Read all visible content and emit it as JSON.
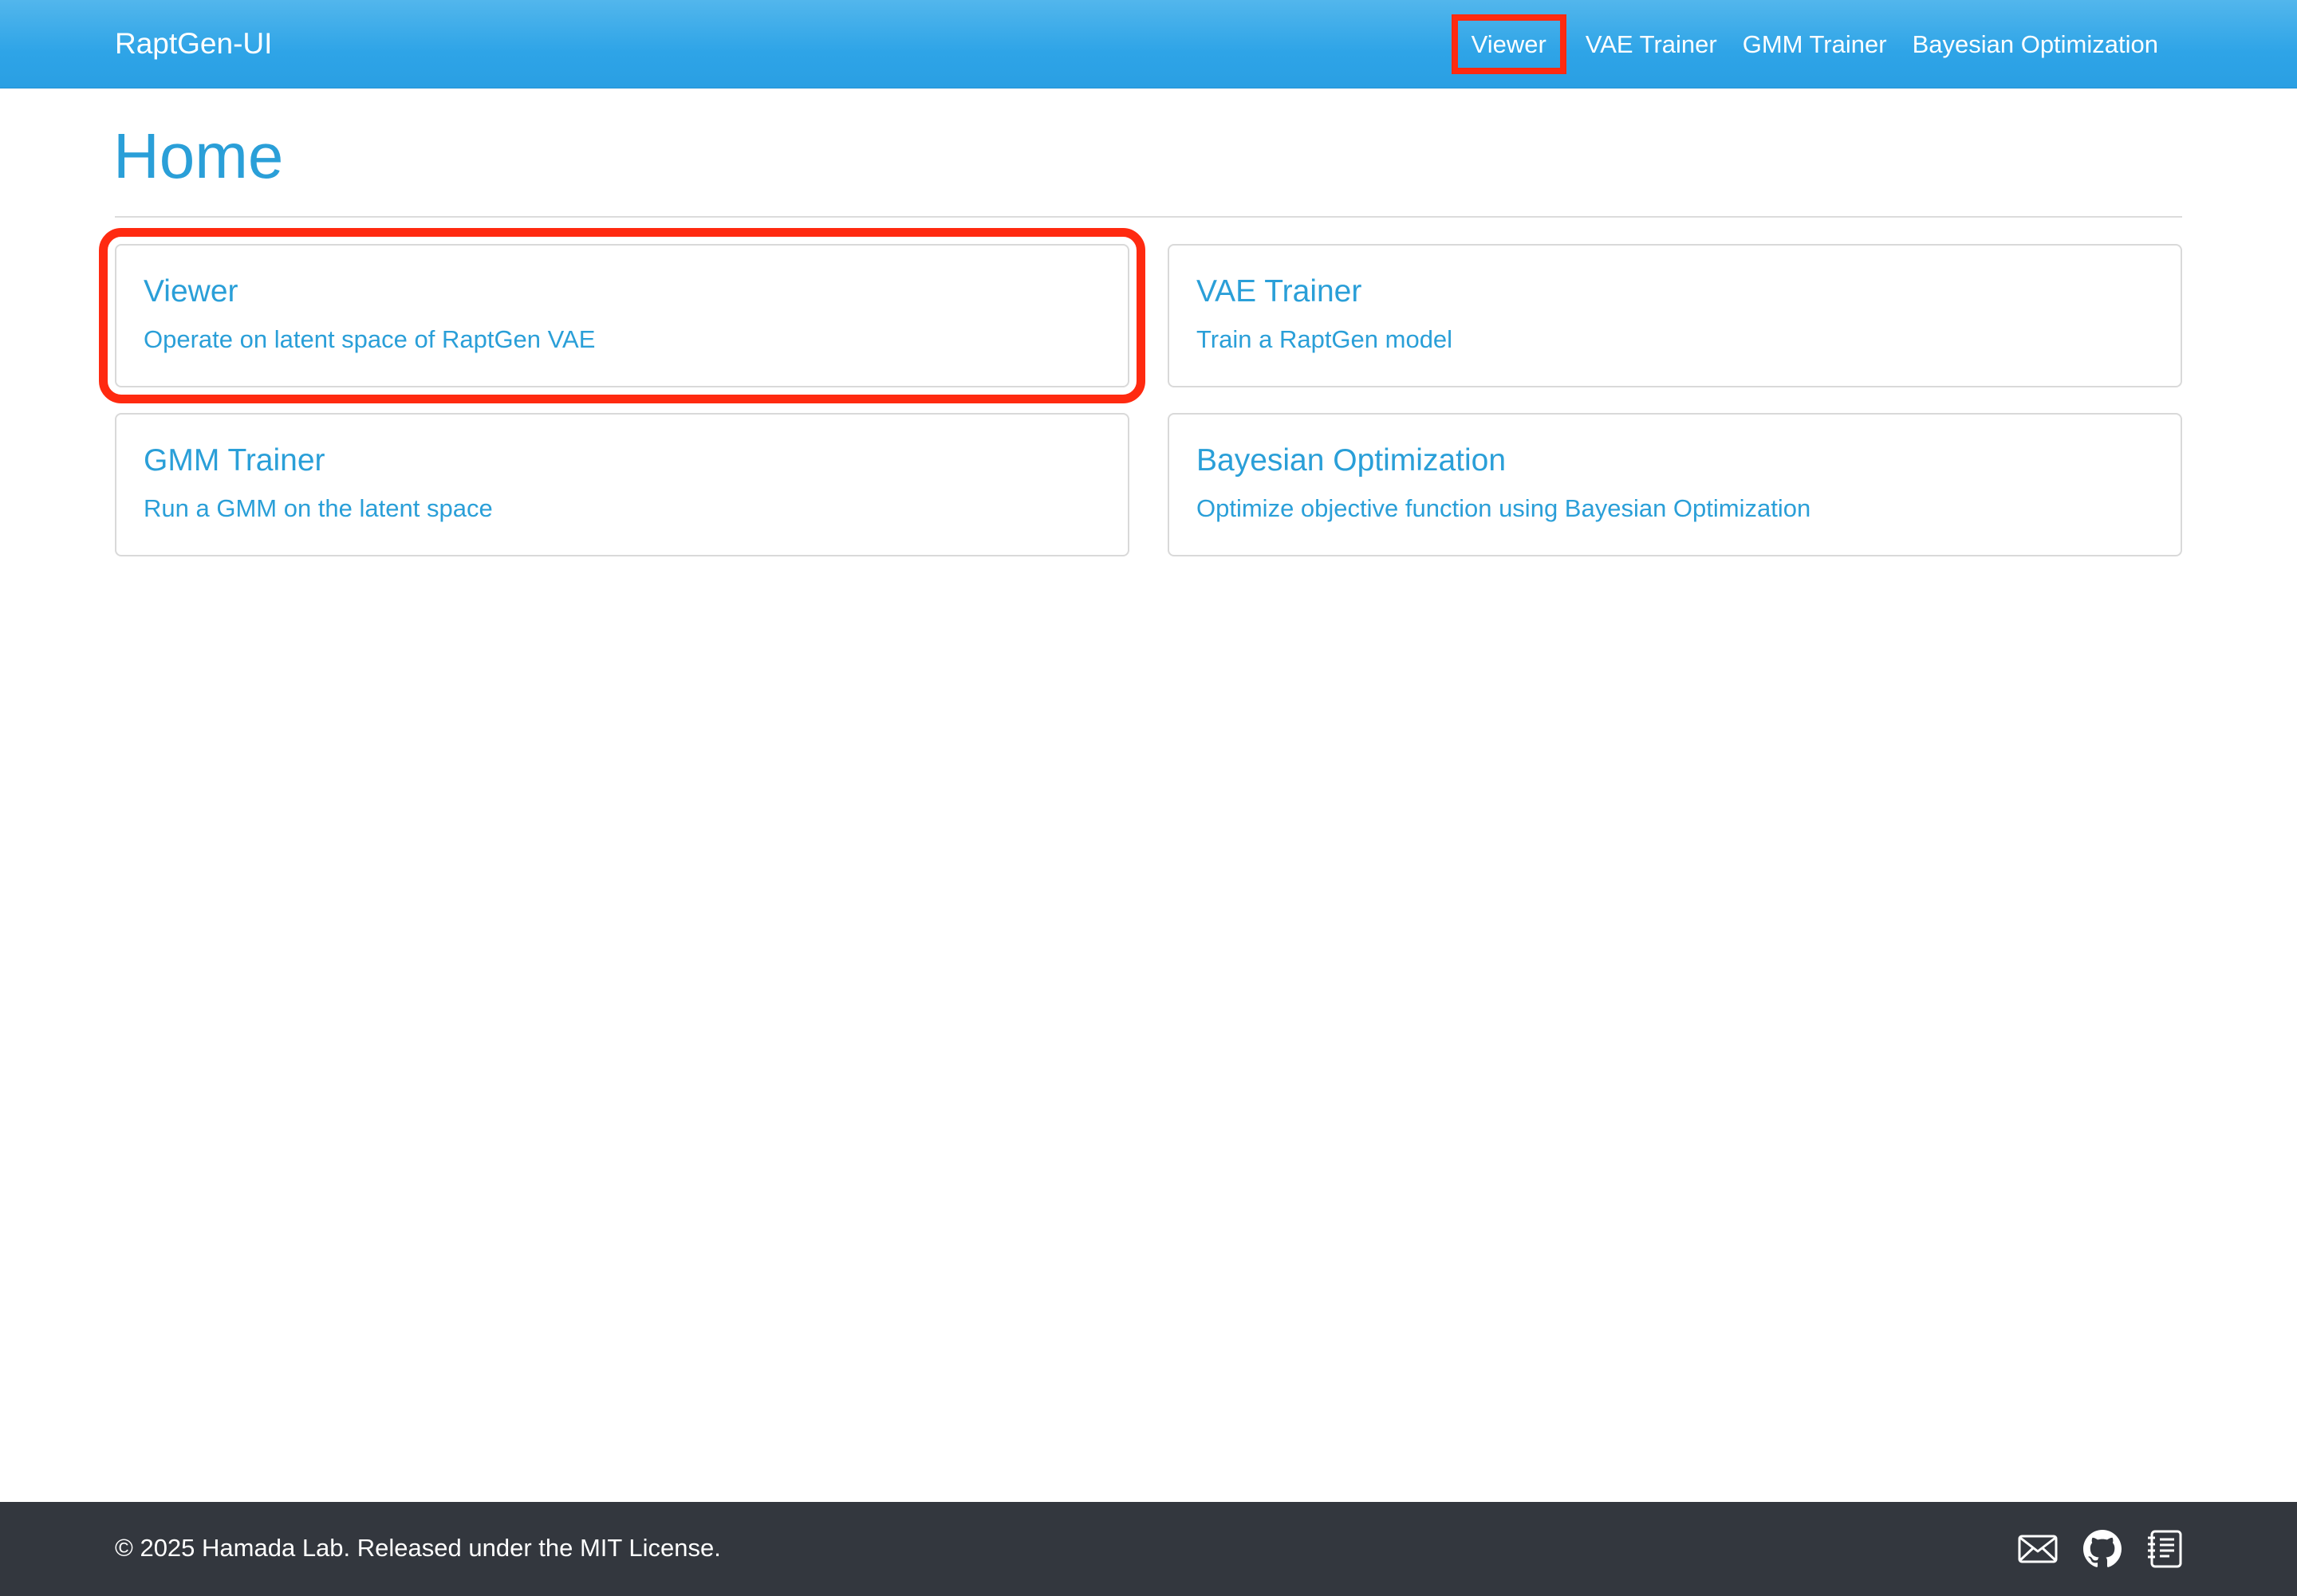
{
  "navbar": {
    "brand": "RaptGen-UI",
    "links": [
      {
        "label": "Viewer"
      },
      {
        "label": "VAE Trainer"
      },
      {
        "label": "GMM Trainer"
      },
      {
        "label": "Bayesian Optimization"
      }
    ]
  },
  "main": {
    "title": "Home",
    "cards": [
      {
        "title": "Viewer",
        "text": "Operate on latent space of RaptGen VAE"
      },
      {
        "title": "VAE Trainer",
        "text": "Train a RaptGen model"
      },
      {
        "title": "GMM Trainer",
        "text": "Run a GMM on the latent space"
      },
      {
        "title": "Bayesian Optimization",
        "text": "Optimize objective function using Bayesian Optimization"
      }
    ]
  },
  "footer": {
    "text": "© 2025 Hamada Lab. Released under the MIT License.",
    "icons": [
      "envelope-icon",
      "github-icon",
      "journal-text-icon"
    ]
  },
  "colors": {
    "navbar": "#2ea4e7",
    "accent_text": "#2a9fd8",
    "footer": "#33373e",
    "highlight": "#ff2a10"
  }
}
